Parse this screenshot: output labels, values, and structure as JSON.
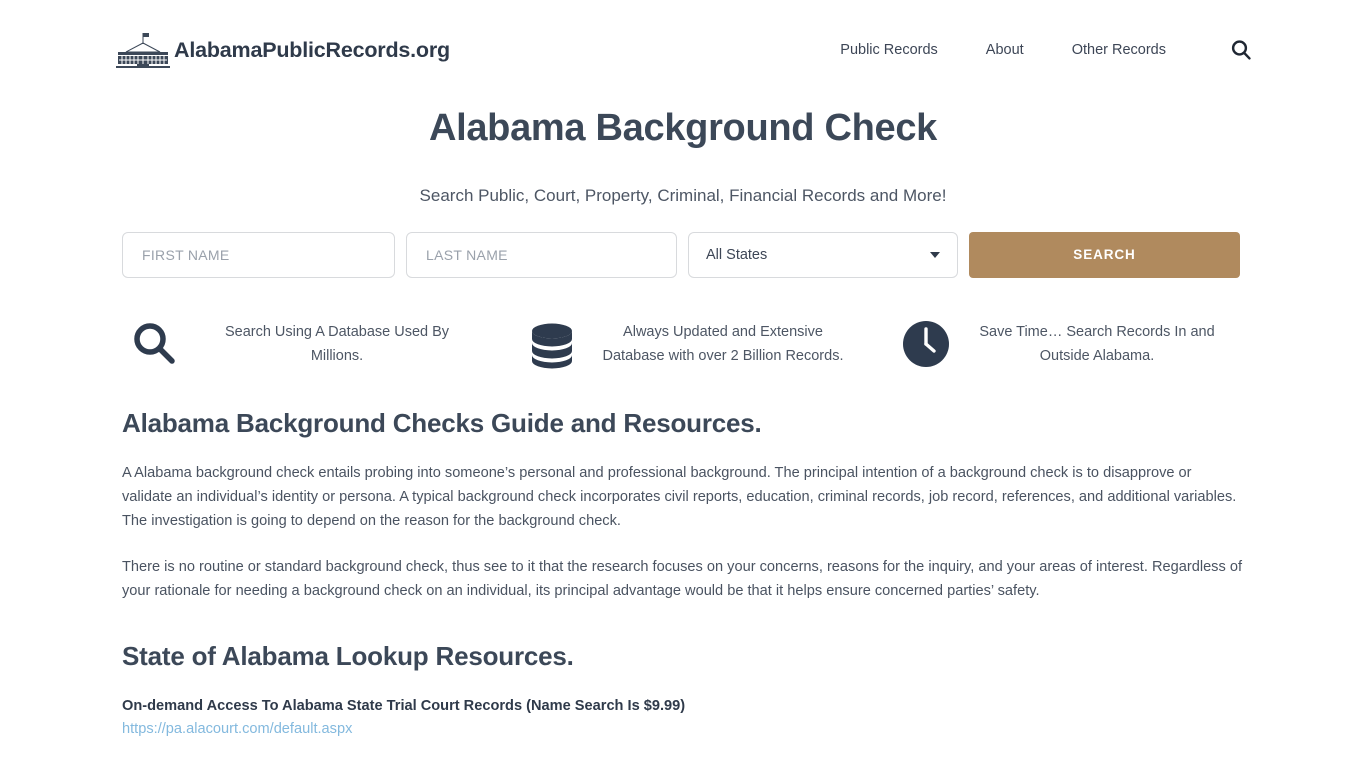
{
  "header": {
    "brand_name": "AlabamaPublicRecords.org",
    "logo_icon": "capitol-building-icon",
    "nav": [
      {
        "label": "Public Records"
      },
      {
        "label": "About"
      },
      {
        "label": "Other Records"
      }
    ],
    "search_icon": "search-icon"
  },
  "hero": {
    "title": "Alabama Background Check",
    "subtitle": "Search Public, Court, Property, Criminal, Financial Records and More!"
  },
  "search_form": {
    "first_name_placeholder": "FIRST NAME",
    "first_name_value": "",
    "last_name_placeholder": "LAST NAME",
    "last_name_value": "",
    "state_selected": "All States",
    "state_caret_icon": "chevron-down-icon",
    "submit_label": "SEARCH",
    "submit_color": "#b08a5e"
  },
  "features": [
    {
      "icon": "magnifier-icon",
      "text": "Search Using A Database Used By Millions."
    },
    {
      "icon": "database-icon",
      "text": "Always Updated and Extensive Database with over 2 Billion Records."
    },
    {
      "icon": "clock-icon",
      "text": "Save Time… Search Records In and Outside Alabama."
    }
  ],
  "article": {
    "heading_1": "Alabama Background Checks Guide and Resources.",
    "paragraph_1": "A Alabama background check entails probing into someone’s personal and professional background. The principal intention of a background check is to disapprove or validate an individual’s identity or persona. A typical background check incorporates civil reports, education, criminal records, job record, references, and additional variables. The investigation is going to depend on the reason for the background check.",
    "paragraph_2": "There is no routine or standard background check, thus see to it that the research focuses on your concerns, reasons for the inquiry, and your areas of interest. Regardless of your rationale for needing a background check on an individual, its principal advantage would be that it helps ensure concerned parties’ safety.",
    "heading_2": "State of Alabama Lookup Resources.",
    "resources": [
      {
        "title": "On-demand Access To Alabama State Trial Court Records (Name Search Is $9.99)",
        "url": "https://pa.alacourt.com/default.aspx"
      }
    ]
  },
  "colors": {
    "heading": "#3c4858",
    "accent": "#b08a5e",
    "link": "#83b9de",
    "icon": "#2e3b4e"
  }
}
